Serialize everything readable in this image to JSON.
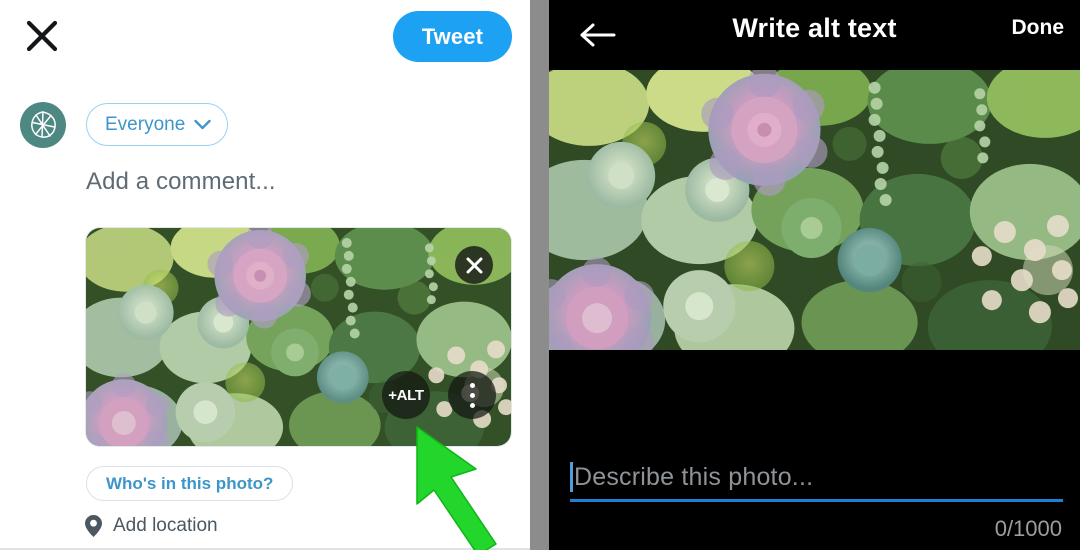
{
  "compose": {
    "close_icon": "close-x-icon",
    "tweet_button": "Tweet",
    "avatar_icon": "leaf-logo-avatar",
    "audience": {
      "label": "Everyone",
      "chevron_icon": "chevron-down-icon"
    },
    "comment_placeholder": "Add a comment...",
    "photo": {
      "alt_badge_label": "+ALT",
      "remove_icon": "close-icon",
      "more_icon": "more-vertical-icon",
      "description": "Overhead photo of a dense succulent garden with pink and purple rosettes among green and sage-colored succulents"
    },
    "whos_in_photo_button": "Who's in this photo?",
    "location": {
      "icon": "location-pin-icon",
      "label": "Add location"
    }
  },
  "alt_text_screen": {
    "back_icon": "arrow-left-icon",
    "title": "Write alt text",
    "done_button": "Done",
    "photo_description": "Overhead photo of a dense succulent garden with pink and purple rosettes among green and sage-colored succulents",
    "input": {
      "value": "",
      "placeholder": "Describe this photo..."
    },
    "char_counter": "0/1000"
  },
  "cursor": {
    "icon": "green-arrow-cursor"
  },
  "colors": {
    "twitter_blue": "#1DA1F2",
    "link_blue": "#3D95C9",
    "avatar_teal": "#4D8882",
    "cursor_green": "#23D62B",
    "dark_bg": "#000000",
    "divider_gray": "#8C8C8C"
  }
}
